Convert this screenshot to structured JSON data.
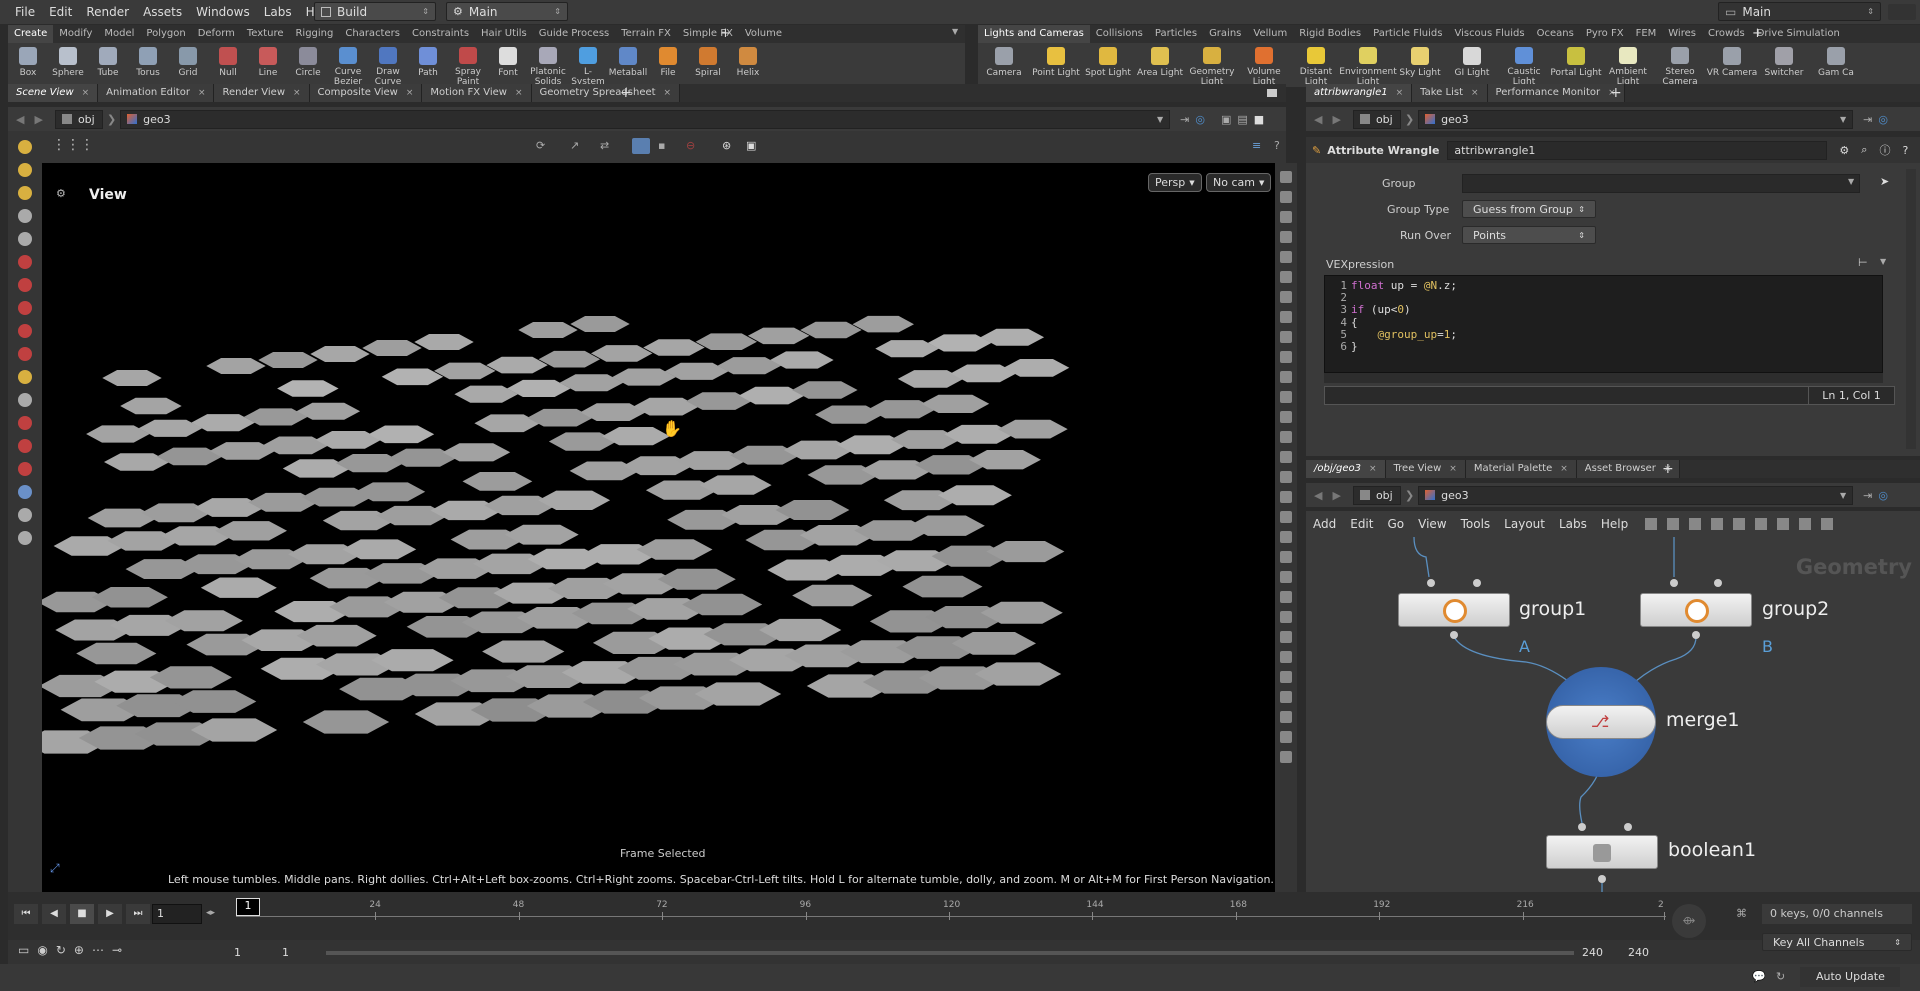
{
  "menu": [
    "File",
    "Edit",
    "Render",
    "Assets",
    "Windows",
    "Labs",
    "Help"
  ],
  "desktop": "Build",
  "context": "Main",
  "right_desktop": "Main",
  "shelf_tabs_left": [
    "Create",
    "Modify",
    "Model",
    "Polygon",
    "Deform",
    "Texture",
    "Rigging",
    "Characters",
    "Constraints",
    "Hair Utils",
    "Guide Process",
    "Terrain FX",
    "Simple FX",
    "Volume"
  ],
  "shelf_tools_left": [
    {
      "label": "Box",
      "color": "#9aa6b8"
    },
    {
      "label": "Sphere",
      "color": "#b8c0cc"
    },
    {
      "label": "Tube",
      "color": "#a0aabb"
    },
    {
      "label": "Torus",
      "color": "#8fa0b5"
    },
    {
      "label": "Grid",
      "color": "#8899aa"
    },
    {
      "label": "Null",
      "color": "#c05050"
    },
    {
      "label": "Line",
      "color": "#c85a5a"
    },
    {
      "label": "Circle",
      "color": "#8b8b9a"
    },
    {
      "label": "Curve Bezier",
      "color": "#5a8fd0"
    },
    {
      "label": "Draw Curve",
      "color": "#5077c0"
    },
    {
      "label": "Path",
      "color": "#6f8fd8"
    },
    {
      "label": "Spray Paint",
      "color": "#c04a4a"
    },
    {
      "label": "Font",
      "color": "#dddddd"
    },
    {
      "label": "Platonic Solids",
      "color": "#a8a8b8"
    },
    {
      "label": "L-System",
      "color": "#4f9ee0"
    },
    {
      "label": "Metaball",
      "color": "#6088c8"
    },
    {
      "label": "File",
      "color": "#e08a30"
    },
    {
      "label": "Spiral",
      "color": "#d07a30"
    },
    {
      "label": "Helix",
      "color": "#d08a40"
    }
  ],
  "shelf_tabs_right": [
    "Lights and Cameras",
    "Collisions",
    "Particles",
    "Grains",
    "Vellum",
    "Rigid Bodies",
    "Particle Fluids",
    "Viscous Fluids",
    "Oceans",
    "Pyro FX",
    "FEM",
    "Wires",
    "Crowds",
    "Drive Simulation"
  ],
  "shelf_tools_right": [
    {
      "label": "Camera",
      "color": "#9aa0aa"
    },
    {
      "label": "Point Light",
      "color": "#e8c040"
    },
    {
      "label": "Spot Light",
      "color": "#e0b840"
    },
    {
      "label": "Area Light",
      "color": "#e0c050"
    },
    {
      "label": "Geometry Light",
      "color": "#d8b040"
    },
    {
      "label": "Volume Light",
      "color": "#e07030"
    },
    {
      "label": "Distant Light",
      "color": "#e8c838"
    },
    {
      "label": "Environment Light",
      "color": "#e0d060"
    },
    {
      "label": "Sky Light",
      "color": "#e8d070"
    },
    {
      "label": "GI Light",
      "color": "#d8d8d8"
    },
    {
      "label": "Caustic Light",
      "color": "#6090d8"
    },
    {
      "label": "Portal Light",
      "color": "#c8c040"
    },
    {
      "label": "Ambient Light",
      "color": "#e8e8c0"
    },
    {
      "label": "Stereo Camera",
      "color": "#9aa0aa"
    },
    {
      "label": "VR Camera",
      "color": "#9aa0aa"
    },
    {
      "label": "Switcher",
      "color": "#a0a0a8"
    },
    {
      "label": "Gam Ca",
      "color": "#9aa0aa"
    }
  ],
  "left_tabs": [
    {
      "label": "Scene View"
    },
    {
      "label": "Animation Editor"
    },
    {
      "label": "Render View"
    },
    {
      "label": "Composite View"
    },
    {
      "label": "Motion FX View"
    },
    {
      "label": "Geometry Spreadsheet"
    }
  ],
  "path": {
    "root": "obj",
    "node": "geo3"
  },
  "viewport": {
    "title": "View",
    "persp": "Persp",
    "cam": "No cam",
    "status": "Frame Selected",
    "hint": "Left mouse tumbles. Middle pans. Right dollies. Ctrl+Alt+Left box-zooms. Ctrl+Right zooms. Spacebar-Ctrl-Left tilts. Hold L for alternate tumble, dolly, and zoom. M or Alt+M for First Person Navigation."
  },
  "param_tabs": [
    {
      "label": "attribwrangle1"
    },
    {
      "label": "Take List"
    },
    {
      "label": "Performance Monitor"
    }
  ],
  "params": {
    "type": "Attribute Wrangle",
    "name": "attribwrangle1",
    "group_label": "Group",
    "group_value": "",
    "group_type_label": "Group Type",
    "group_type": "Guess from Group",
    "run_over_label": "Run Over",
    "run_over": "Points",
    "vex_label": "VEXpression",
    "cursor": "Ln 1, Col 1"
  },
  "code_lines": [
    "float up = @N.z;",
    "",
    "if (up<0)",
    "{",
    "    @group_up=1;",
    "}"
  ],
  "network_tabs": [
    {
      "label": "/obj/geo3"
    },
    {
      "label": "Tree View"
    },
    {
      "label": "Material Palette"
    },
    {
      "label": "Asset Browser"
    }
  ],
  "network_menu": [
    "Add",
    "Edit",
    "Go",
    "View",
    "Tools",
    "Layout",
    "Labs",
    "Help"
  ],
  "network": {
    "context": "Geometry",
    "nodes": {
      "group1": "group1",
      "group2": "group2",
      "merge": "merge1",
      "boolean": "boolean1"
    },
    "input_a": "A",
    "input_b": "B"
  },
  "timeline": {
    "frame": "1",
    "ticks": [
      "1",
      "24",
      "48",
      "72",
      "96",
      "120",
      "144",
      "168",
      "192",
      "216",
      "2"
    ],
    "start": "1",
    "start2": "1",
    "end": "240",
    "end2": "240",
    "keys": "0 keys, 0/0 channels",
    "key_mode": "Key All Channels",
    "update": "Auto Update"
  }
}
